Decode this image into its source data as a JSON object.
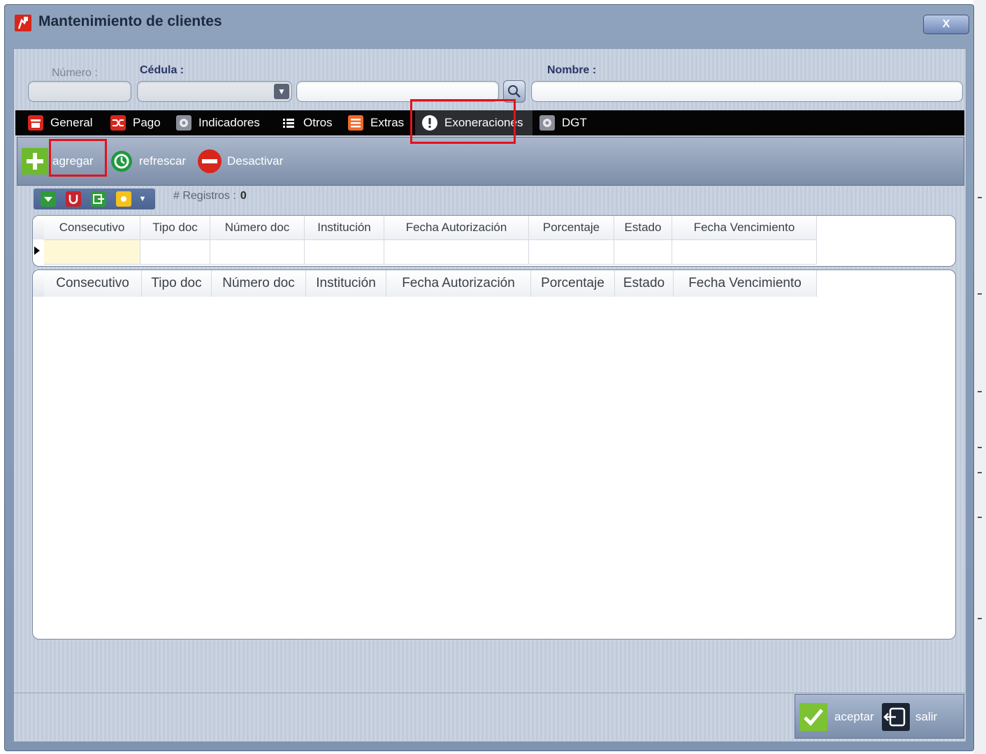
{
  "window": {
    "title": "Mantenimiento de clientes",
    "close_label": "X"
  },
  "search": {
    "numero_label": "Número :",
    "cedula_label": "Cédula :",
    "nombre_label": "Nombre :",
    "numero_value": "",
    "cedula_type_value": "",
    "cedula_value": "",
    "nombre_value": ""
  },
  "tabs": [
    {
      "label": "General",
      "icon": "store-icon",
      "color": "#d8261c"
    },
    {
      "label": "Pago",
      "icon": "shuffle-icon",
      "color": "#d8261c"
    },
    {
      "label": "Indicadores",
      "icon": "gear-icon",
      "color": "#c9ccd3"
    },
    {
      "label": "Otros",
      "icon": "list-icon",
      "color": "#ffffff"
    },
    {
      "label": "Extras",
      "icon": "list-icon",
      "color": "#f0692b"
    },
    {
      "label": "Exoneraciones",
      "icon": "alert-icon",
      "color": "#ffffff",
      "active": true
    },
    {
      "label": "DGT",
      "icon": "gear-icon",
      "color": "#c9ccd3"
    }
  ],
  "toolbar": {
    "add_label": "agregar",
    "refresh_label": "refrescar",
    "deactivate_label": "Desactivar"
  },
  "records": {
    "label": "# Registros :",
    "count": "0"
  },
  "grid": {
    "columns": [
      "Consecutivo",
      "Tipo doc",
      "Número doc",
      "Institución",
      "Fecha Autorización",
      "Porcentaje",
      "Estado",
      "Fecha Vencimiento"
    ]
  },
  "footer": {
    "accept_label": "aceptar",
    "exit_label": "salir"
  },
  "colors": {
    "highlight": "#e0141c",
    "selected_cell": "#fff8d6",
    "tabbar": "#050505"
  }
}
